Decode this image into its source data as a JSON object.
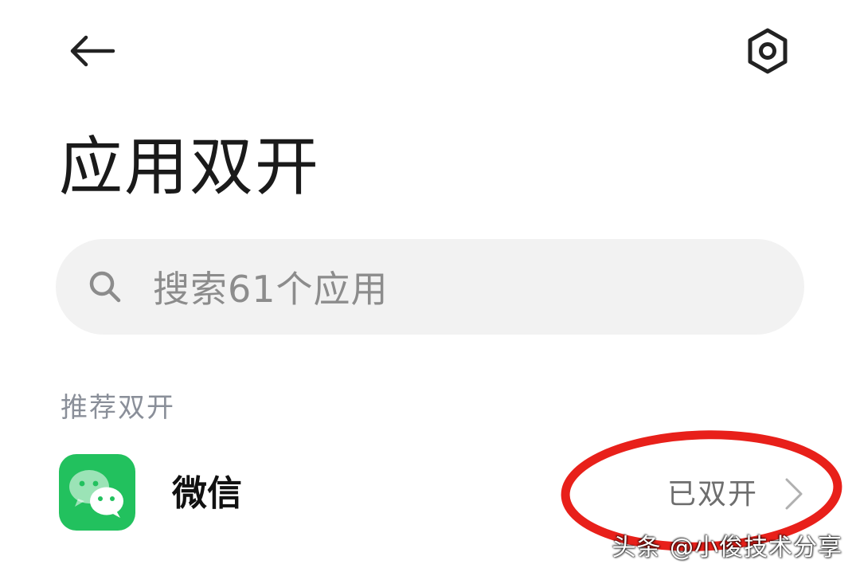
{
  "header": {
    "back_icon": "arrow-left-icon",
    "settings_icon": "hexagon-gear-icon"
  },
  "page": {
    "title": "应用双开"
  },
  "search": {
    "placeholder": "搜索61个应用",
    "icon": "search-icon"
  },
  "section": {
    "header": "推荐双开"
  },
  "apps": [
    {
      "name": "微信",
      "status": "已双开",
      "icon": "wechat-icon",
      "icon_color": "#22c15e"
    }
  ],
  "annotation": {
    "highlight_color": "#e8201a"
  },
  "watermark": {
    "text": "头条 @小俊技术分享"
  }
}
